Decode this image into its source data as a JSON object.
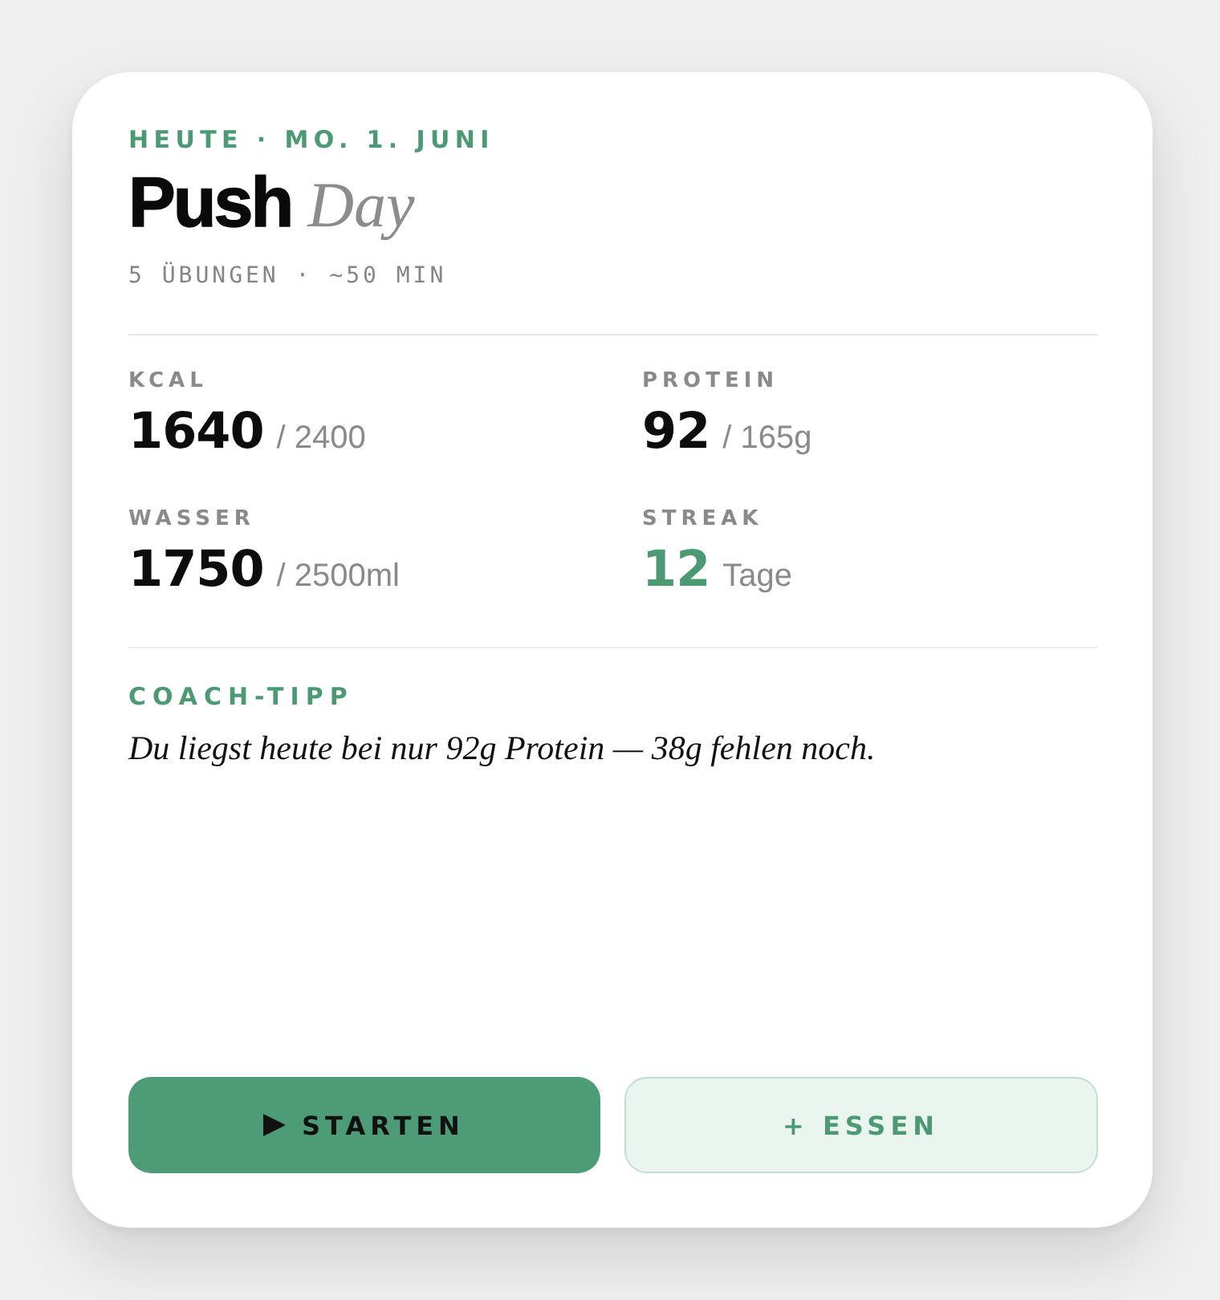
{
  "header": {
    "date": "HEUTE · MO. 1. JUNI",
    "title": "Push",
    "title_accent": "Day",
    "subtitle": "5 ÜBUNGEN · ~50 MIN"
  },
  "stats": [
    {
      "label": "KCAL",
      "value": "1640",
      "target": "/ 2400",
      "highlight": false
    },
    {
      "label": "PROTEIN",
      "value": "92",
      "target": "/ 165g",
      "highlight": false
    },
    {
      "label": "WASSER",
      "value": "1750",
      "target": "/ 2500ml",
      "highlight": false
    },
    {
      "label": "STREAK",
      "value": "12",
      "target": "Tage",
      "highlight": true
    }
  ],
  "coach": {
    "label": "COACH-TIPP",
    "text": "Du liegst heute bei nur 92g Protein — 38g fehlen noch."
  },
  "buttons": [
    {
      "kind": "primary",
      "label": "STARTEN"
    },
    {
      "kind": "secondary",
      "label": "+ ESSEN"
    }
  ]
}
